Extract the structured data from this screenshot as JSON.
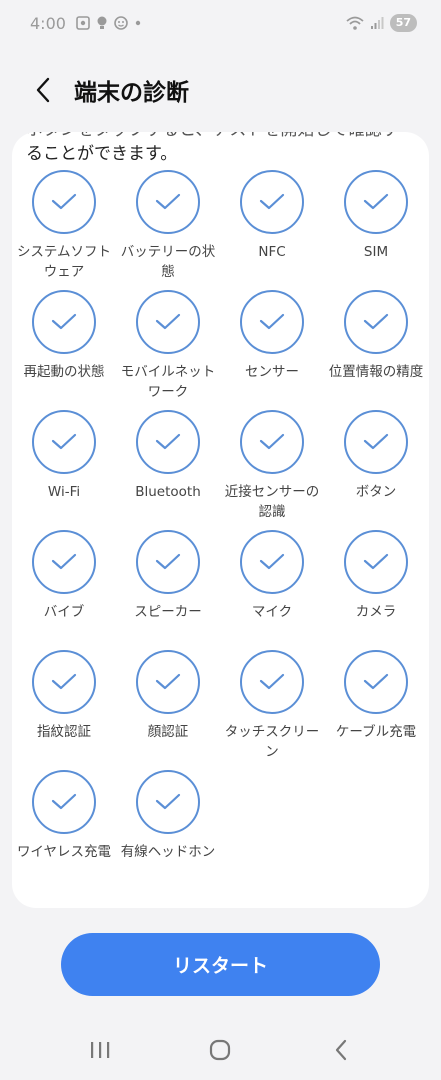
{
  "status_bar": {
    "time": "4:00",
    "icons": [
      "screenshot-icon",
      "bulb-icon",
      "face-icon",
      "dot-icon"
    ],
    "battery": "57"
  },
  "header": {
    "title": "端末の診断"
  },
  "description": {
    "partial_line": "ボタンをタップすると、テストを開始して確認す",
    "visible_line": "ることができます。"
  },
  "tests": [
    {
      "label": "システムソフトウェア"
    },
    {
      "label": "バッテリーの状態"
    },
    {
      "label": "NFC"
    },
    {
      "label": "SIM"
    },
    {
      "label": "再起動の状態"
    },
    {
      "label": "モバイルネットワーク"
    },
    {
      "label": "センサー"
    },
    {
      "label": "位置情報の精度"
    },
    {
      "label": "Wi-Fi"
    },
    {
      "label": "Bluetooth"
    },
    {
      "label": "近接センサーの認識"
    },
    {
      "label": "ボタン"
    },
    {
      "label": "バイブ"
    },
    {
      "label": "スピーカー"
    },
    {
      "label": "マイク"
    },
    {
      "label": "カメラ"
    },
    {
      "label": "指紋認証"
    },
    {
      "label": "顔認証"
    },
    {
      "label": "タッチスクリーン"
    },
    {
      "label": "ケーブル充電"
    },
    {
      "label": "ワイヤレス充電"
    },
    {
      "label": "有線ヘッドホン"
    }
  ],
  "restart_button": {
    "label": "リスタート"
  },
  "colors": {
    "accent": "#3f82f0",
    "check": "#5b8fd6",
    "background": "#f3f3f5"
  }
}
